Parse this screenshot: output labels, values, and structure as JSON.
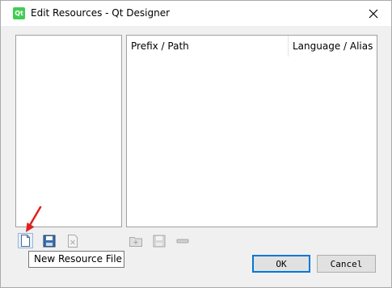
{
  "window": {
    "title": "Edit Resources - Qt Designer",
    "app_icon_label": "Qt"
  },
  "resource_table": {
    "columns": [
      "Prefix / Path",
      "Language / Alias"
    ]
  },
  "toolbar_left": {
    "buttons": [
      {
        "icon": "new-file-icon",
        "active": true
      },
      {
        "icon": "save-icon",
        "active": true
      },
      {
        "icon": "remove-file-icon",
        "active": false
      }
    ]
  },
  "toolbar_right": {
    "buttons": [
      {
        "icon": "add-folder-icon",
        "active": false
      },
      {
        "icon": "save-icon",
        "active": false
      },
      {
        "icon": "minus-icon",
        "active": false
      }
    ]
  },
  "tooltip": {
    "text": "New Resource File"
  },
  "dialog_buttons": {
    "ok": "OK",
    "cancel": "Cancel"
  },
  "colors": {
    "accent": "#0078d7",
    "arrow": "#e02020",
    "qt_green": "#41cd52"
  }
}
